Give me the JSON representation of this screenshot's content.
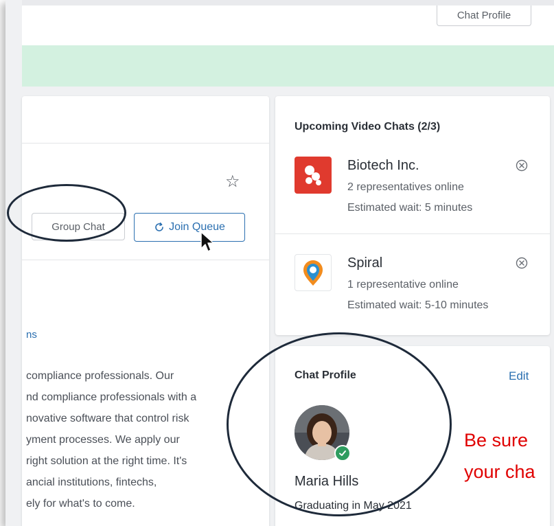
{
  "header": {
    "chat_profile_button": "Chat Profile"
  },
  "booth": {
    "group_chat_label": "Group Chat",
    "join_queue_label": "Join Queue",
    "link_fragment": "ns",
    "description_lines": [
      "compliance professionals. Our",
      "nd compliance professionals with a",
      "novative software that control risk",
      "yment processes. We apply our",
      "right solution at the right time. It's",
      "ancial institutions, fintechs,",
      "ely for what's to come."
    ]
  },
  "upcoming": {
    "title": "Upcoming Video Chats (2/3)",
    "items": [
      {
        "name": "Biotech Inc.",
        "reps": "2 representatives online",
        "wait": "Estimated wait: 5 minutes",
        "logo_color": "#e03a2e"
      },
      {
        "name": "Spiral",
        "reps": "1 representative online",
        "wait": "Estimated wait: 5-10 minutes",
        "logo_color": "#f28c1e"
      }
    ]
  },
  "profile": {
    "title": "Chat Profile",
    "edit_label": "Edit",
    "name": "Maria Hills",
    "graduation": "Graduating in May 2021"
  },
  "annotation": {
    "line1": "Be sure",
    "line2": "your cha",
    "color": "#e00000"
  },
  "colors": {
    "accent": "#2a6fb0",
    "banner": "#d3f1e0",
    "online": "#2e9c5f"
  }
}
